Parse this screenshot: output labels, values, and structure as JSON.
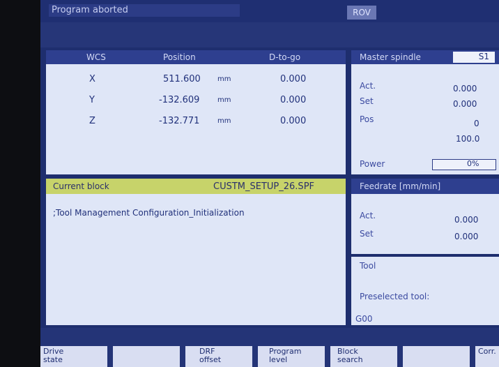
{
  "top": {
    "mode_label": "Program aborted",
    "channel_label": "ROV"
  },
  "position_panel": {
    "headers": {
      "axis": "WCS",
      "position": "Position",
      "dist": "D-to-go"
    },
    "rows": [
      {
        "axis": "X",
        "value": "511.600",
        "unit": "mm",
        "dist": "0.000"
      },
      {
        "axis": "Y",
        "value": "-132.609",
        "unit": "mm",
        "dist": "0.000"
      },
      {
        "axis": "Z",
        "value": "-132.771",
        "unit": "mm",
        "dist": "0.000"
      }
    ]
  },
  "spindle_panel": {
    "title": "Master spindle",
    "spindle_id": "S1",
    "act_label": "Act.",
    "act_value": "0.000",
    "set_label": "Set",
    "set_value": "0.000",
    "pos_label": "Pos",
    "pos_value": "0",
    "override_value": "100.0",
    "power_label": "Power",
    "power_value": "0%"
  },
  "block_panel": {
    "title": "Current block",
    "program_name": "CUSTM_SETUP_26.SPF",
    "line": ";Tool Management Configuration_Initialization"
  },
  "feed_panel": {
    "title": "Feedrate [mm/min]",
    "act_label": "Act.",
    "act_value": "0.000",
    "set_label": "Set",
    "set_value": "0.000"
  },
  "tool_panel": {
    "tool_label": "Tool",
    "preselected_label": "Preselected tool:",
    "g_label": "G00"
  },
  "softkeys": [
    {
      "label": "Drive\nstate"
    },
    {
      "label": ""
    },
    {
      "label": "DRF\noffset"
    },
    {
      "label": "Program\nlevel"
    },
    {
      "label": "Block\nsearch"
    },
    {
      "label": ""
    },
    {
      "label": "Corr."
    }
  ]
}
